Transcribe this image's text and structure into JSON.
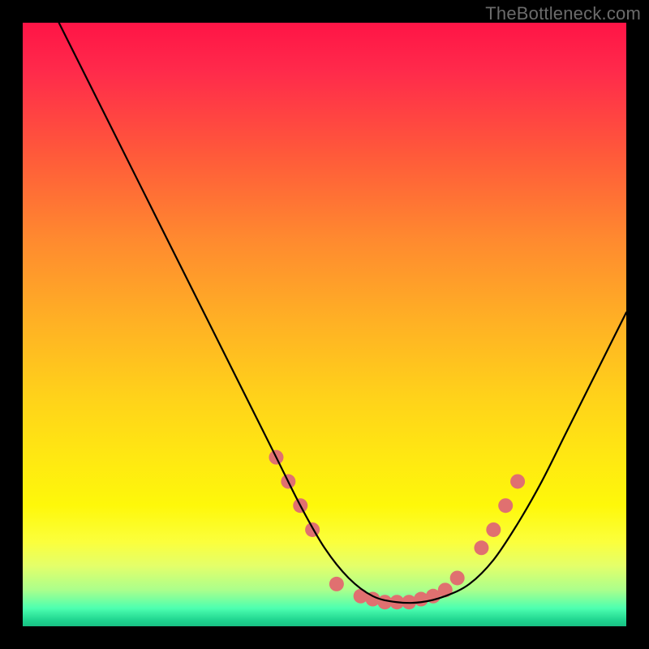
{
  "watermark": "TheBottleneck.com",
  "chart_data": {
    "type": "line",
    "title": "",
    "xlabel": "",
    "ylabel": "",
    "xlim": [
      0,
      100
    ],
    "ylim": [
      0,
      100
    ],
    "grid": false,
    "series": [
      {
        "name": "bottleneck-curve",
        "color": "#000000",
        "x": [
          6,
          10,
          14,
          18,
          22,
          26,
          30,
          34,
          38,
          42,
          46,
          50,
          54,
          58,
          62,
          66,
          70,
          74,
          78,
          82,
          86,
          90,
          94,
          98,
          100
        ],
        "y": [
          100,
          92,
          84,
          76,
          68,
          60,
          52,
          44,
          36,
          28,
          20,
          13,
          8,
          5,
          4,
          4,
          5,
          7,
          11,
          17,
          24,
          32,
          40,
          48,
          52
        ]
      }
    ],
    "markers": {
      "name": "highlight-points",
      "color": "#e07070",
      "radius": 9,
      "x": [
        42,
        44,
        46,
        48,
        52,
        56,
        58,
        60,
        62,
        64,
        66,
        68,
        70,
        72,
        76,
        78,
        80,
        82
      ],
      "y": [
        28,
        24,
        20,
        16,
        7,
        5,
        4.5,
        4,
        4,
        4,
        4.5,
        5,
        6,
        8,
        13,
        16,
        20,
        24
      ]
    }
  }
}
